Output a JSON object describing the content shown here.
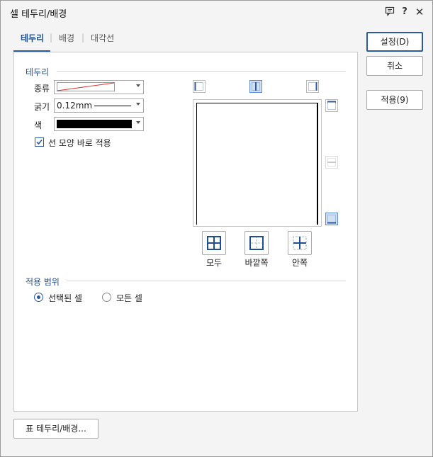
{
  "window": {
    "title": "셀 테두리/배경"
  },
  "titlebar_icons": [
    "comment-icon",
    "help-icon",
    "close-icon"
  ],
  "titlebar_glyphs": {
    "help": "?",
    "close": "✕"
  },
  "tabs": [
    {
      "label": "테두리",
      "active": true
    },
    {
      "label": "배경",
      "active": false
    },
    {
      "label": "대각선",
      "active": false
    }
  ],
  "border_section": {
    "title": "테두리",
    "type_label": "종류",
    "thickness_label": "굵기",
    "thickness_value": "0.12mm",
    "color_label": "색",
    "color_value": "#000000",
    "apply_shape_label": "선 모양 바로 적용",
    "apply_shape_checked": true
  },
  "preset_buttons": [
    {
      "label": "모두",
      "icon": "all-borders-icon"
    },
    {
      "label": "바깥쪽",
      "icon": "outer-borders-icon"
    },
    {
      "label": "안쪽",
      "icon": "inner-borders-icon"
    }
  ],
  "scope_section": {
    "title": "적용 범위",
    "options": [
      {
        "label": "선택된 셀",
        "selected": true
      },
      {
        "label": "모든 셀",
        "selected": false
      }
    ]
  },
  "buttons": {
    "ok": "설정(D)",
    "cancel": "취소",
    "apply": "적용(9)",
    "table_border": "표 테두리/배경..."
  },
  "colors": {
    "accent": "#2c5aa0",
    "selected_icon_bg": "#cfe0f5"
  }
}
